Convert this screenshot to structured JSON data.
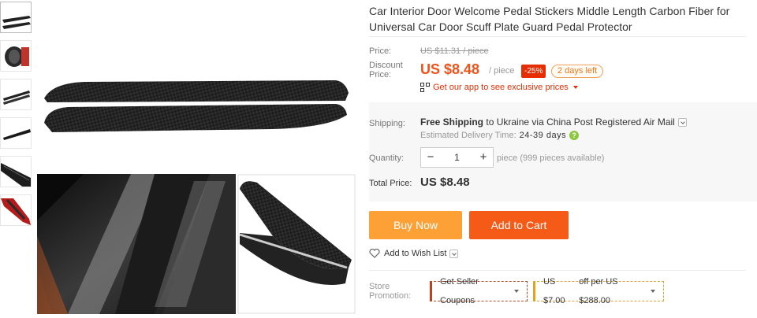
{
  "thumbnails": [
    {
      "name": "thumb-1",
      "active": true
    },
    {
      "name": "thumb-2"
    },
    {
      "name": "thumb-3"
    },
    {
      "name": "thumb-4"
    },
    {
      "name": "thumb-5"
    },
    {
      "name": "thumb-6"
    }
  ],
  "product": {
    "title": "Car Interior Door Welcome Pedal Stickers Middle Length Carbon Fiber for Universal Car Door Scuff Plate Guard Pedal Protector"
  },
  "pricing": {
    "price_label": "Price:",
    "original_price": "US $11.31 / piece",
    "discount_label_1": "Discount",
    "discount_label_2": "Price:",
    "current_price": "US $8.48",
    "per_piece": "/ piece",
    "discount_pct": "-25%",
    "time_left": "2 days left",
    "app_prices": "Get our app to see exclusive prices"
  },
  "shipping": {
    "label": "Shipping:",
    "free": "Free Shipping",
    "to": "to",
    "country": "Ukraine",
    "via": "via",
    "carrier": "China Post Registered Air Mail",
    "est_label": "Estimated Delivery Time:",
    "est_days": "24-39 days"
  },
  "quantity": {
    "label": "Quantity:",
    "minus": "−",
    "value": "1",
    "plus": "+",
    "available": "piece (999 pieces available)"
  },
  "total": {
    "label": "Total Price:",
    "value": "US $8.48"
  },
  "actions": {
    "buy_now": "Buy Now",
    "add_to_cart": "Add to Cart",
    "wish_list": "Add to Wish List"
  },
  "store_promo": {
    "label_1": "Store",
    "label_2": "Promotion:",
    "coupon_1": "Get Seller Coupons",
    "coupon_2_amount": "US $7.00",
    "coupon_2_rest": "off per US $288.00"
  },
  "colors": {
    "price": "#f0521a",
    "buy_now": "#fda036",
    "add_to_cart": "#f55b17",
    "discount_badge": "#e62e04"
  }
}
